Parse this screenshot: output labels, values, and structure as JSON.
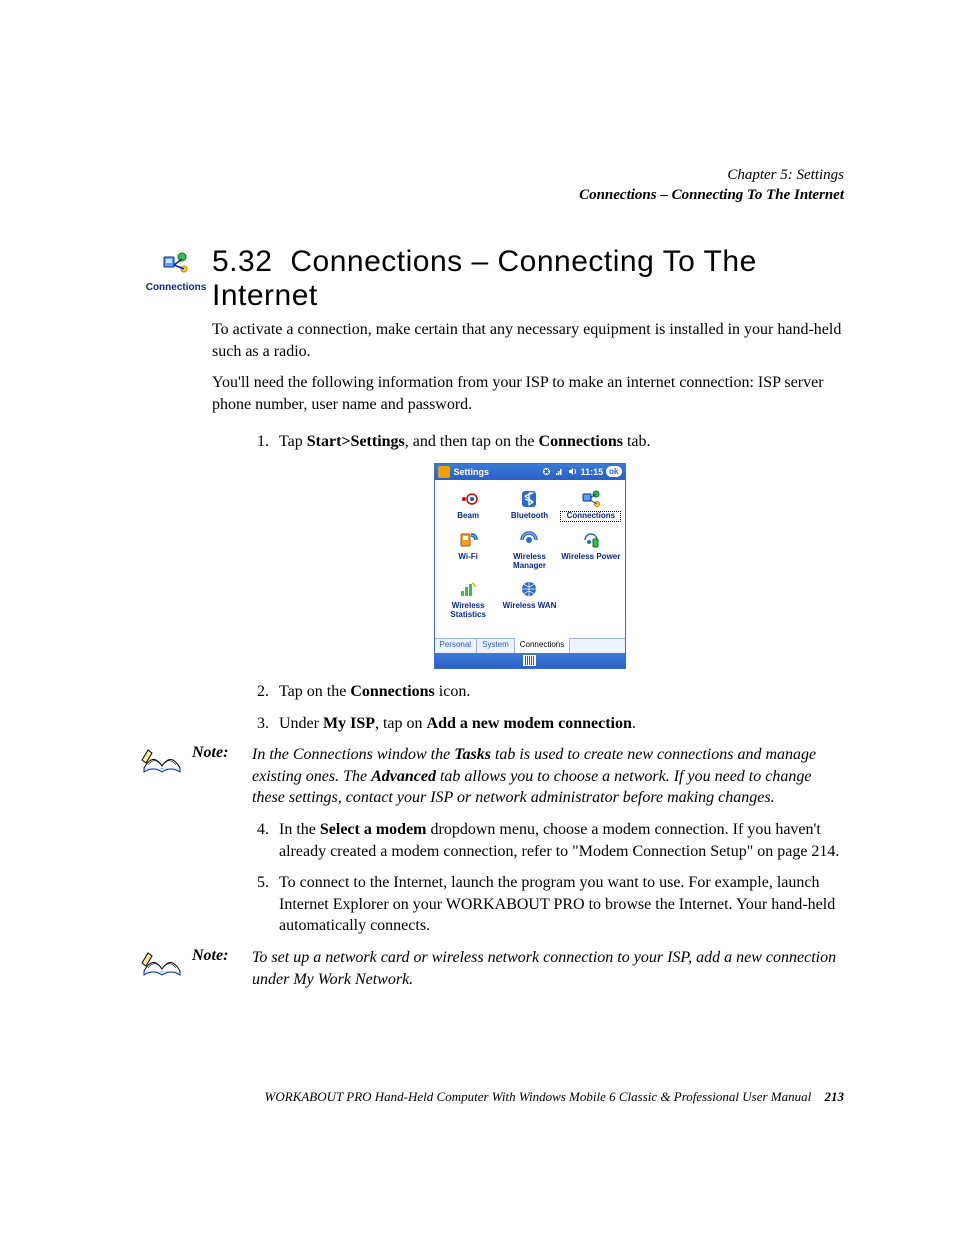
{
  "runningHead": {
    "chapter": "Chapter 5: Settings",
    "section": "Connections – Connecting To The Internet"
  },
  "badge": {
    "label": "Connections"
  },
  "heading": {
    "number": "5.32",
    "title": "Connections – Connecting To The Internet"
  },
  "intro": {
    "p1": "To activate a connection, make certain that any necessary equipment is installed in your hand-held such as a radio.",
    "p2": "You'll need the following information from your ISP to make an internet connection: ISP server phone number, user name and password."
  },
  "step1": {
    "pre": "Tap ",
    "bold1": "Start>Settings",
    "mid": ", and then tap on the ",
    "bold2": "Connections",
    "post": " tab."
  },
  "screenshot": {
    "title": "Settings",
    "time": "11:15",
    "ok": "ok",
    "tiles": [
      {
        "name": "Beam"
      },
      {
        "name": "Bluetooth"
      },
      {
        "name": "Connections",
        "selected": true
      },
      {
        "name": "Wi-Fi"
      },
      {
        "name": "Wireless Manager"
      },
      {
        "name": "Wireless Power"
      },
      {
        "name": "Wireless Statistics"
      },
      {
        "name": "Wireless WAN"
      }
    ],
    "tabs": {
      "t1": "Personal",
      "t2": "System",
      "t3": "Connections"
    }
  },
  "step2": {
    "pre": "Tap on the ",
    "bold1": "Connections",
    "post": " icon."
  },
  "step3": {
    "pre": "Under ",
    "bold1": "My ISP",
    "mid": ", tap on ",
    "bold2": "Add a new modem connection",
    "post": "."
  },
  "note1": {
    "label": "Note:",
    "t1": "In the Connections window the ",
    "b1": "Tasks",
    "t2": " tab is used to create new connections and manage existing ones. The ",
    "b2": "Advanced",
    "t3": " tab allows you to choose a network. If you need to change these settings, contact your ISP or network administrator before making changes."
  },
  "step4": {
    "pre": "In the ",
    "bold1": "Select a modem",
    "post": " dropdown menu, choose a modem connection. If you haven't already created a modem connection, refer to \"Modem Connection Setup\" on page 214."
  },
  "step5": {
    "text": "To connect to the Internet, launch the program you want to use. For example, launch Internet Explorer on your WORKABOUT PRO to browse the Internet. Your hand-held automatically connects."
  },
  "note2": {
    "label": "Note:",
    "text": "To set up a network card or wireless network connection to your ISP, add a new connection under My Work Network."
  },
  "footer": {
    "text": "WORKABOUT PRO Hand-Held Computer With Windows Mobile 6 Classic & Professional User Manual",
    "page": "213"
  }
}
